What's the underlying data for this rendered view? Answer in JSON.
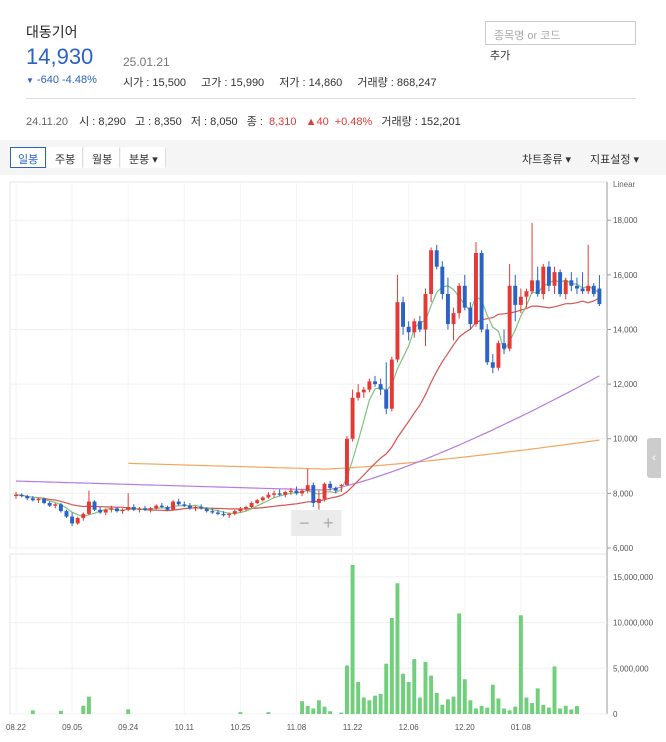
{
  "stock": {
    "name": "대동기어",
    "price": "14,930",
    "date": "25.01.21",
    "change": "-640",
    "change_pct": "-4.48%",
    "open": "시가 : 15,500",
    "high": "고가 : 15,990",
    "low": "저가 : 14,860",
    "volume": "거래량 : 868,247"
  },
  "search": {
    "placeholder": "종목명 or 코드",
    "add_label": "추가"
  },
  "prev": {
    "date": "24.11.20",
    "open": "시 : 8,290",
    "high": "고 : 8,350",
    "low": "저 : 8,050",
    "close_label": "종 :",
    "close": "8,310",
    "diff": "▲40",
    "pct": "+0.48%",
    "volume": "거래량 : 152,201"
  },
  "toolbar": {
    "daily": "일봉",
    "weekly": "주봉",
    "monthly": "월봉",
    "minute": "분봉 ▾",
    "chart_type": "차트종류 ▾",
    "indicator": "지표설정 ▾"
  },
  "colors": {
    "up": "#e53935",
    "down": "#2b62c6",
    "ma5": "#7cc47f",
    "ma20": "#d9534f",
    "ma60": "#b57be0",
    "ma120": "#f0a860",
    "volume": "#6fcf7a"
  },
  "chart_data": {
    "type": "candlestick",
    "scale_label": "Linear",
    "price_ticks": [
      6000,
      8000,
      10000,
      12000,
      14000,
      16000,
      18000
    ],
    "price_tick_labels": [
      "6,000",
      "8,000",
      "10,000",
      "12,000",
      "14,000",
      "16,000",
      "18,000"
    ],
    "price_range": [
      6000,
      19400
    ],
    "volume_ticks": [
      0,
      5000000,
      10000000,
      15000000
    ],
    "volume_tick_labels": [
      "0",
      "5,000,000",
      "10,000,000",
      "15,000,000"
    ],
    "volume_range": [
      0,
      17500000
    ],
    "x_labels": [
      "08.22",
      "09.05",
      "09.24",
      "10.11",
      "10.25",
      "11.08",
      "11.22",
      "12.06",
      "12.20",
      "01.08"
    ],
    "x_label_index": [
      0,
      10,
      20,
      30,
      40,
      50,
      60,
      70,
      80,
      90
    ],
    "candles": [
      [
        7900,
        8050,
        7800,
        7950
      ],
      [
        7950,
        8000,
        7850,
        7900
      ],
      [
        7900,
        7950,
        7750,
        7820
      ],
      [
        7820,
        7900,
        7700,
        7750
      ],
      [
        7750,
        7850,
        7650,
        7800
      ],
      [
        7800,
        7850,
        7600,
        7650
      ],
      [
        7650,
        7700,
        7500,
        7550
      ],
      [
        7550,
        7650,
        7450,
        7600
      ],
      [
        7600,
        7650,
        7300,
        7350
      ],
      [
        7350,
        7400,
        7100,
        7150
      ],
      [
        7150,
        7300,
        6800,
        6900
      ],
      [
        6900,
        7150,
        6850,
        7100
      ],
      [
        7100,
        7300,
        7000,
        7250
      ],
      [
        7250,
        8100,
        7200,
        7700
      ],
      [
        7700,
        7750,
        7350,
        7400
      ],
      [
        7400,
        7500,
        7250,
        7300
      ],
      [
        7300,
        7450,
        7200,
        7400
      ],
      [
        7400,
        7550,
        7300,
        7450
      ],
      [
        7450,
        7500,
        7300,
        7350
      ],
      [
        7350,
        7450,
        7250,
        7400
      ],
      [
        7400,
        8000,
        7350,
        7500
      ],
      [
        7500,
        7600,
        7350,
        7400
      ],
      [
        7400,
        7500,
        7300,
        7450
      ],
      [
        7450,
        7550,
        7350,
        7400
      ],
      [
        7400,
        7500,
        7300,
        7450
      ],
      [
        7450,
        7600,
        7400,
        7550
      ],
      [
        7550,
        7650,
        7450,
        7500
      ],
      [
        7500,
        7550,
        7350,
        7400
      ],
      [
        7400,
        7750,
        7380,
        7700
      ],
      [
        7700,
        7800,
        7550,
        7600
      ],
      [
        7600,
        7700,
        7500,
        7550
      ],
      [
        7550,
        7650,
        7400,
        7450
      ],
      [
        7450,
        7550,
        7350,
        7500
      ],
      [
        7500,
        7600,
        7400,
        7450
      ],
      [
        7450,
        7500,
        7300,
        7350
      ],
      [
        7350,
        7450,
        7250,
        7300
      ],
      [
        7300,
        7400,
        7200,
        7250
      ],
      [
        7250,
        7350,
        7150,
        7200
      ],
      [
        7200,
        7300,
        7100,
        7250
      ],
      [
        7250,
        7400,
        7200,
        7350
      ],
      [
        7350,
        7500,
        7300,
        7450
      ],
      [
        7450,
        7550,
        7350,
        7500
      ],
      [
        7500,
        7700,
        7450,
        7650
      ],
      [
        7650,
        7800,
        7600,
        7750
      ],
      [
        7750,
        7900,
        7700,
        7850
      ],
      [
        7850,
        8050,
        7800,
        7950
      ],
      [
        7950,
        8100,
        7850,
        8000
      ],
      [
        8000,
        8150,
        7900,
        7950
      ],
      [
        7950,
        8100,
        7850,
        8050
      ],
      [
        8050,
        8200,
        7950,
        8100
      ],
      [
        8100,
        8250,
        7950,
        8000
      ],
      [
        8000,
        8150,
        7900,
        8100
      ],
      [
        8100,
        8900,
        8000,
        8300
      ],
      [
        8300,
        8400,
        7500,
        7650
      ],
      [
        7650,
        8100,
        7400,
        7800
      ],
      [
        7800,
        8400,
        7700,
        8350
      ],
      [
        8350,
        8450,
        8100,
        8200
      ],
      [
        8200,
        8250,
        8000,
        8100
      ],
      [
        8290,
        8350,
        8050,
        8310
      ],
      [
        8310,
        10100,
        8300,
        10000
      ],
      [
        10000,
        11800,
        9900,
        11500
      ],
      [
        11500,
        12000,
        11400,
        11700
      ],
      [
        11700,
        11900,
        11500,
        11800
      ],
      [
        11800,
        12200,
        11700,
        12100
      ],
      [
        12100,
        12300,
        11900,
        12000
      ],
      [
        12000,
        12200,
        11600,
        11800
      ],
      [
        11800,
        12800,
        10900,
        11100
      ],
      [
        11100,
        13000,
        11000,
        12900
      ],
      [
        12900,
        16000,
        12800,
        15000
      ],
      [
        15000,
        15200,
        13800,
        14100
      ],
      [
        14100,
        14300,
        13600,
        13900
      ],
      [
        13900,
        14400,
        13700,
        14300
      ],
      [
        14300,
        14500,
        13900,
        14000
      ],
      [
        14000,
        15500,
        13400,
        15300
      ],
      [
        15300,
        17000,
        15000,
        16900
      ],
      [
        16900,
        17100,
        16200,
        16300
      ],
      [
        16300,
        16500,
        15100,
        15300
      ],
      [
        15300,
        15900,
        14000,
        14200
      ],
      [
        14200,
        14800,
        13600,
        14600
      ],
      [
        14600,
        15700,
        14400,
        15600
      ],
      [
        15600,
        16000,
        14700,
        14800
      ],
      [
        14800,
        15000,
        14000,
        14200
      ],
      [
        14200,
        17200,
        14100,
        16800
      ],
      [
        16800,
        16900,
        13900,
        14000
      ],
      [
        14000,
        14200,
        12700,
        12800
      ],
      [
        12800,
        13100,
        12400,
        12600
      ],
      [
        12600,
        13600,
        12500,
        13500
      ],
      [
        13500,
        14000,
        13100,
        13300
      ],
      [
        13300,
        16400,
        13200,
        15600
      ],
      [
        15600,
        16000,
        14300,
        14900
      ],
      [
        14900,
        15500,
        14600,
        15200
      ],
      [
        15200,
        15500,
        14800,
        15400
      ],
      [
        15400,
        17900,
        15300,
        15800
      ],
      [
        15800,
        16300,
        15200,
        15300
      ],
      [
        15300,
        16400,
        15100,
        16300
      ],
      [
        16300,
        16500,
        15400,
        15600
      ],
      [
        15600,
        16300,
        15300,
        16100
      ],
      [
        16100,
        16200,
        15200,
        15300
      ],
      [
        15300,
        15900,
        15100,
        15800
      ],
      [
        15800,
        16100,
        15400,
        15600
      ],
      [
        15600,
        15900,
        15300,
        15500
      ],
      [
        15500,
        16100,
        15300,
        15400
      ],
      [
        15400,
        17100,
        15300,
        15600
      ],
      [
        15600,
        15700,
        15200,
        15300
      ],
      [
        15500,
        15990,
        14860,
        14930
      ]
    ],
    "volumes": [
      0,
      0,
      0,
      0,
      0,
      0,
      0,
      0,
      0,
      0,
      0,
      0,
      0,
      0,
      0,
      0,
      0,
      0,
      0,
      0,
      0,
      0,
      0,
      0,
      0,
      0,
      0,
      0,
      0,
      0,
      0,
      0,
      0,
      0,
      0,
      0,
      0,
      0,
      0,
      0,
      0,
      0,
      0,
      0,
      0,
      0,
      0,
      0,
      0,
      0,
      0,
      0,
      0,
      0,
      0,
      0,
      0,
      0,
      0,
      0,
      0,
      0,
      0,
      0,
      0,
      0,
      0,
      0,
      0,
      0,
      0,
      0,
      0,
      0,
      0,
      0,
      0,
      0,
      0,
      0,
      0,
      0,
      0,
      0,
      0,
      0,
      0,
      0,
      0,
      0,
      0,
      0,
      0,
      0,
      0,
      0,
      0,
      0,
      0,
      0,
      0,
      0,
      0,
      0,
      0,
      0
    ],
    "volume_spikes": {
      "51": 1400000,
      "52": 900000,
      "53": 600000,
      "54": 1500000,
      "55": 800000,
      "56": 300000,
      "58": 152201,
      "59": 5300000,
      "60": 16300000,
      "61": 3500000,
      "62": 1800000,
      "63": 1500000,
      "64": 2000000,
      "65": 2200000,
      "66": 5500000,
      "67": 10500000,
      "68": 14300000,
      "69": 4400000,
      "70": 3500000,
      "71": 6000000,
      "72": 1800000,
      "73": 5700000,
      "74": 4200000,
      "75": 2300000,
      "76": 1000000,
      "77": 1600000,
      "78": 1900000,
      "79": 11000000,
      "80": 3800000,
      "81": 1500000,
      "82": 600000,
      "83": 900000,
      "84": 700000,
      "85": 3200000,
      "86": 1700000,
      "87": 600000,
      "88": 400000,
      "89": 800000,
      "90": 10800000,
      "91": 1800000,
      "92": 1200000,
      "93": 2800000,
      "94": 1000000,
      "95": 700000,
      "96": 5200000,
      "97": 600000,
      "98": 900000,
      "99": 500000,
      "100": 868247,
      "3": 400000,
      "8": 350000,
      "12": 900000,
      "13": 1900000,
      "20": 500000,
      "40": 200000,
      "45": 200000
    },
    "ma120_start_index": 20
  }
}
